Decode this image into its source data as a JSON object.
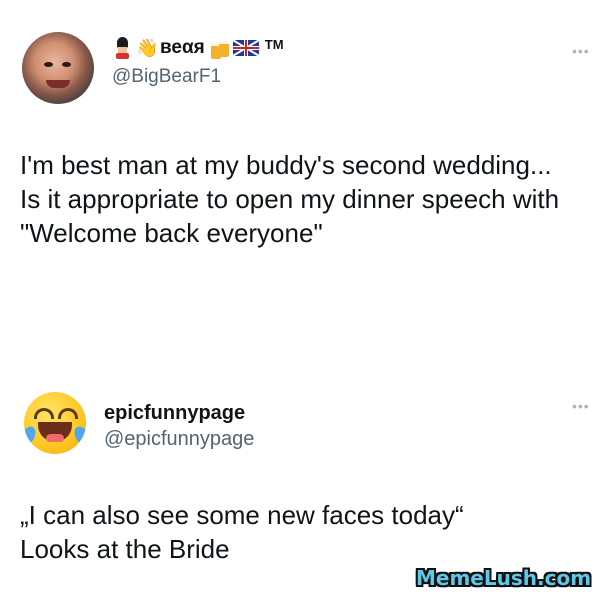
{
  "tweets": [
    {
      "display_name": "веαя",
      "name_emojis": [
        "guard-icon",
        "waving-hand-icon",
        "beer-mugs-icon",
        "uk-flag-icon"
      ],
      "name_suffix": "TM",
      "handle": "@BigBearF1",
      "avatar": "profile-photo",
      "text": "I'm best man at my buddy's second wedding...\nIs it appropriate to open my dinner speech with\n\"Welcome back everyone\""
    },
    {
      "display_name": "epicfunnypage",
      "handle": "@epicfunnypage",
      "avatar": "face-with-tears-of-joy-emoji",
      "text": "„I can also see some new faces today“\nLooks at the Bride"
    }
  ],
  "more_icon": "more-options-icon",
  "watermark": "MemeLush.com",
  "colors": {
    "text": "#0f1419",
    "handle": "#536471",
    "watermark": "#5ec8e8"
  }
}
